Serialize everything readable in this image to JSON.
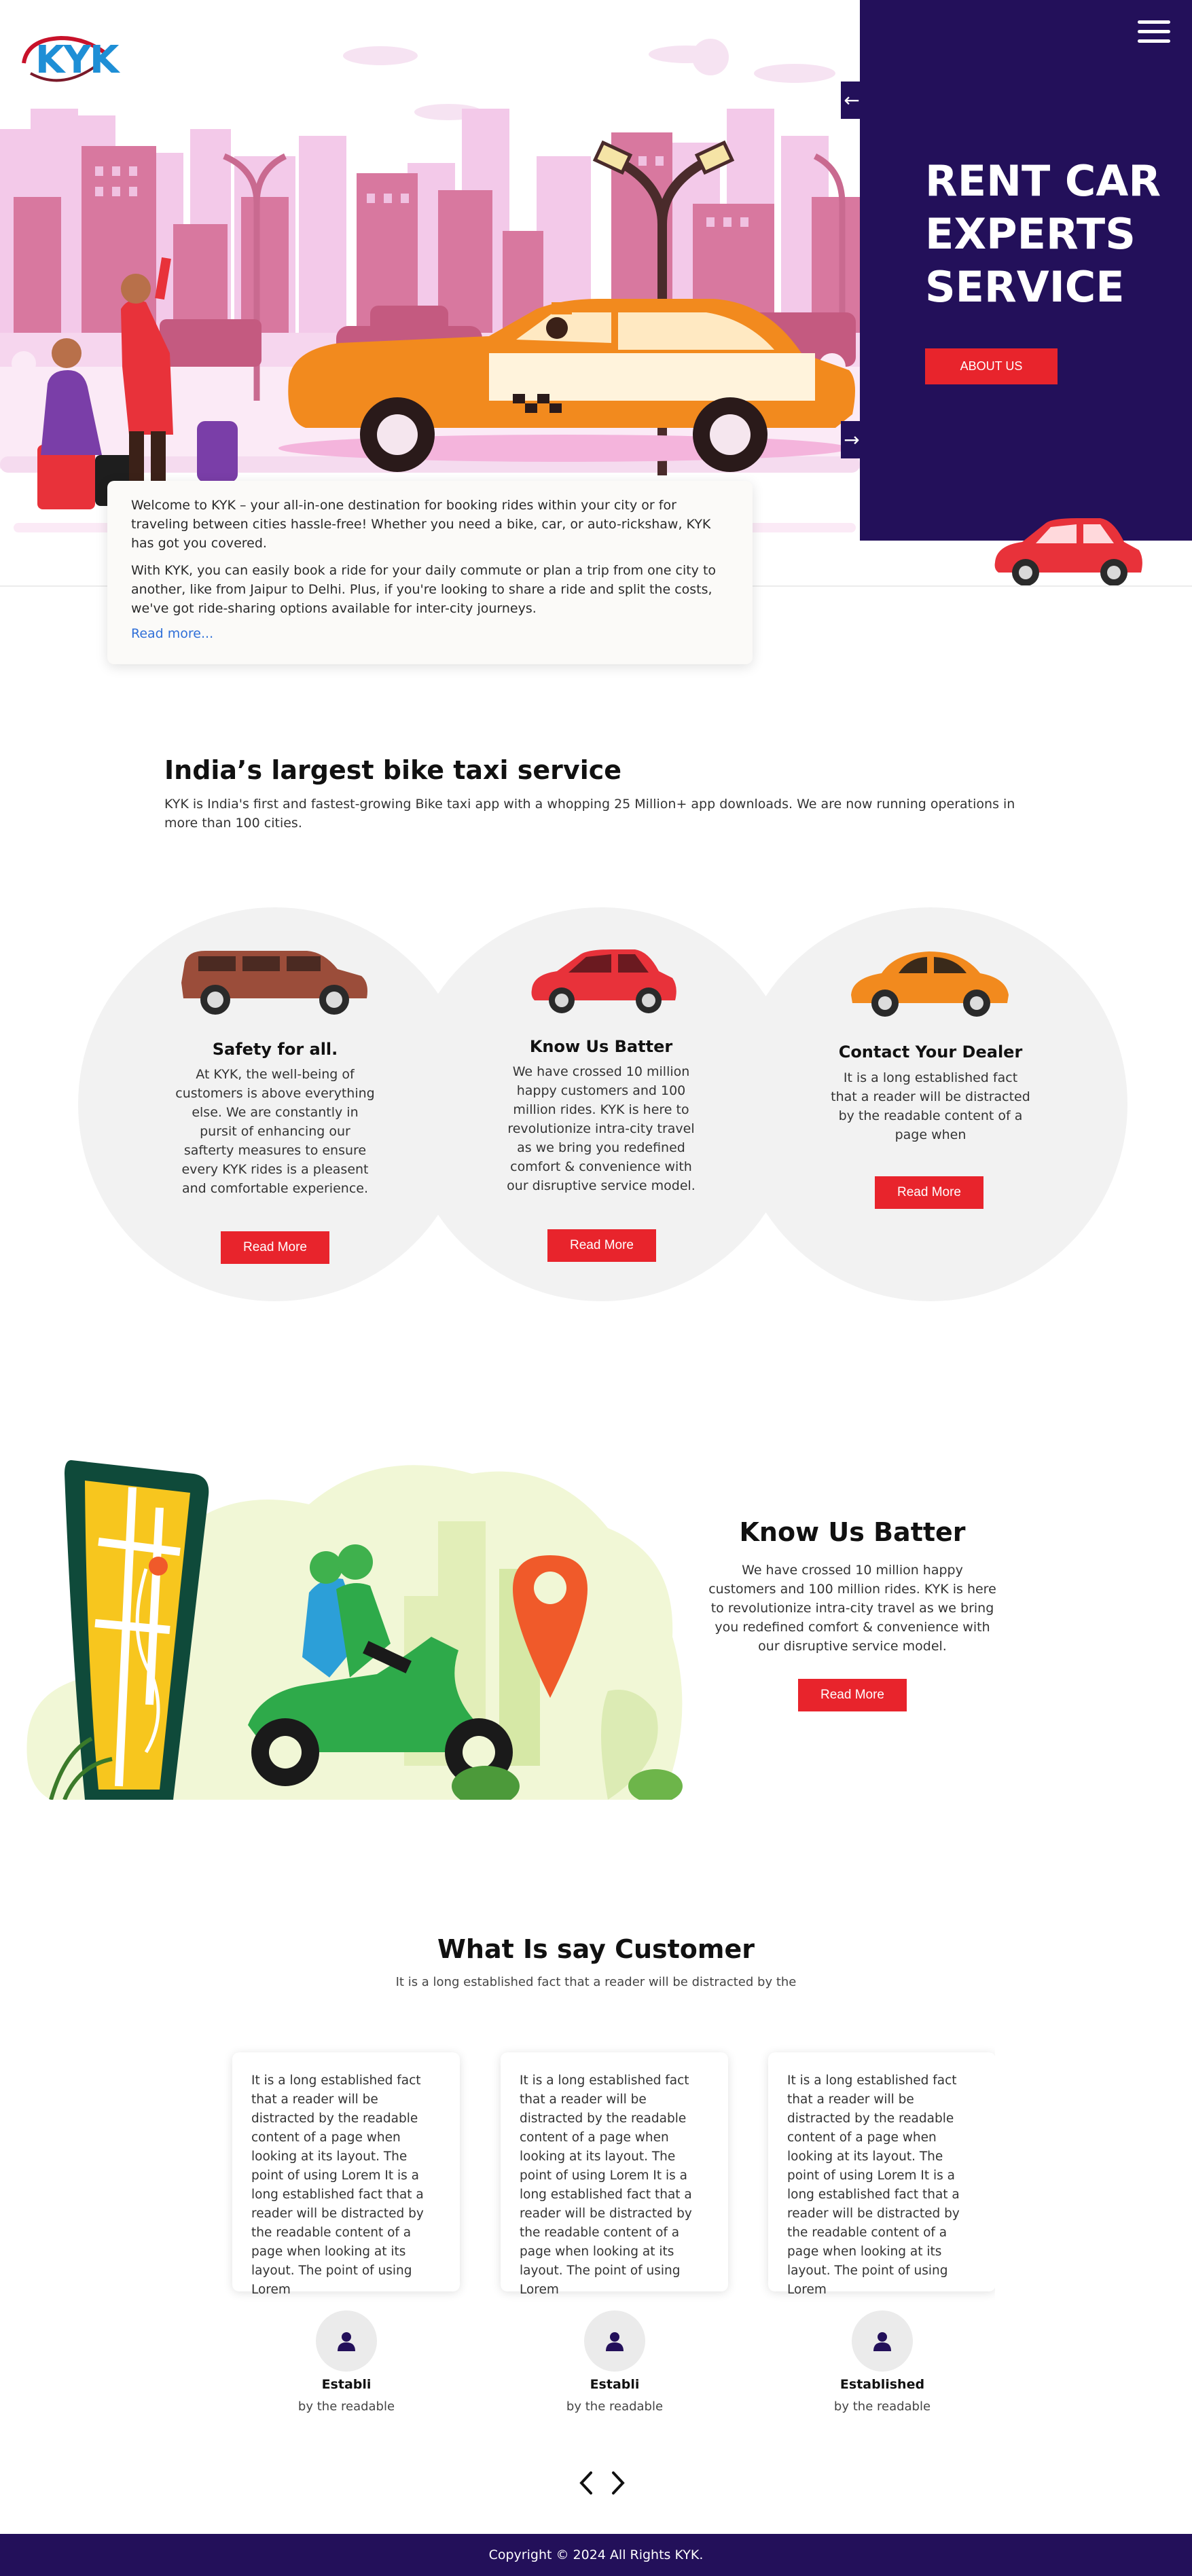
{
  "brand": {
    "logo_text": "KYK"
  },
  "hero": {
    "title": "RENT CAR EXPERTS SERVICE",
    "about_button": "ABOUT US",
    "prev_arrow": "←",
    "next_arrow": "→"
  },
  "intro": {
    "paragraph_1": "Welcome to KYK – your all-in-one destination for booking rides within your city or for traveling between cities hassle-free! Whether you need a bike, car, or auto-rickshaw, KYK has got you covered.",
    "paragraph_2": "With KYK, you can easily book a ride for your daily commute or plan a trip from one city to another, like from Jaipur to Delhi. Plus, if you're looking to share a ride and split the costs, we've got ride-sharing options available for inter-city journeys.",
    "read_more": "Read more..."
  },
  "bike_taxi": {
    "title": "India’s largest bike taxi service",
    "description": "KYK is India's first and fastest-growing Bike taxi app with a whopping 25 Million+ app downloads. We are now running operations in more than 100 cities."
  },
  "features": [
    {
      "title": "Safety for all.",
      "text": "At KYK, the well-being of customers is above everything else. We are constantly in pursit of enhancing our safterty measures to ensure every KYK rides is a pleasent and comfortable experience.",
      "button": "Read More",
      "car_color": "#9b4d3a"
    },
    {
      "title": "Know Us Batter",
      "text": "We have crossed 10 million happy customers and 100 million rides. KYK is here to revolutionize intra-city travel as we bring you redefined comfort & convenience with our disruptive service model.",
      "button": "Read More",
      "car_color": "#e8323a"
    },
    {
      "title": "Contact Your Dealer",
      "text": "It is a long established fact that a reader will be distracted by the readable content of a page when",
      "button": "Read More",
      "car_color": "#f28a1e"
    }
  ],
  "know_us": {
    "title": "Know Us Batter",
    "text": "We have crossed 10 million happy customers and 100 million rides. KYK is here to revolutionize intra-city travel as we bring you redefined comfort & convenience with our disruptive service model.",
    "button": "Read More"
  },
  "testimonials": {
    "title": "What Is say Customer",
    "subtitle": "It is a long established fact that a reader will be distracted by the",
    "items": [
      {
        "quote": "It is a long established fact that a reader will be distracted by the readable content of a page when looking at its layout. The point of using Lorem It is a long established fact that a reader will be distracted by the readable content of a page when looking at its layout. The point of using Lorem",
        "name": "Establi",
        "role": "by the readable"
      },
      {
        "quote": "It is a long established fact that a reader will be distracted by the readable content of a page when looking at its layout. The point of using Lorem It is a long established fact that a reader will be distracted by the readable content of a page when looking at its layout. The point of using Lorem",
        "name": "Establi",
        "role": "by the readable"
      },
      {
        "quote": "It is a long established fact that a reader will be distracted by the readable content of a page when looking at its layout. The point of using Lorem It is a long established fact that a reader will be distracted by the readable content of a page when looking at its layout. The point of using Lorem",
        "name": "Established",
        "role": "by the readable"
      }
    ],
    "prev_icon": "chevron-left-icon",
    "next_icon": "chevron-right-icon"
  },
  "footer": {
    "copyright": "Copyright © 2024 All Rights KYK."
  },
  "colors": {
    "navy": "#23105a",
    "accent_red": "#e8242c",
    "link_blue": "#2f6fd8",
    "circle_grey": "#f2f2f2"
  }
}
